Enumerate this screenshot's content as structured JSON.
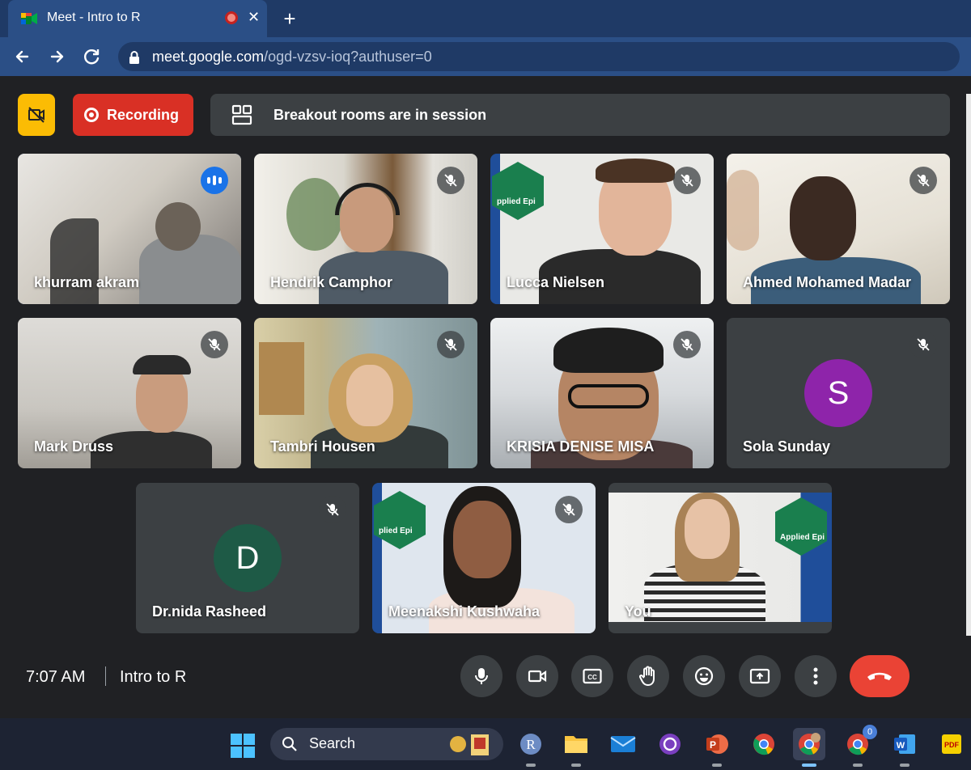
{
  "browser": {
    "tab_title": "Meet - Intro to R",
    "new_tab": "+",
    "close_tab": "✕",
    "url_host": "meet.google.com",
    "url_path": "/ogd-vzsv-ioq?authuser=0"
  },
  "meet": {
    "recording_label": "Recording",
    "breakout_label": "Breakout rooms are in session",
    "time": "7:07 AM",
    "meeting_title": "Intro to R",
    "participants": [
      {
        "name": "khurram akram"
      },
      {
        "name": "Hendrik Camphor"
      },
      {
        "name": "Lucca Nielsen"
      },
      {
        "name": "Ahmed Mohamed Madar"
      },
      {
        "name": "Mark Druss"
      },
      {
        "name": "Tambri Housen"
      },
      {
        "name": "KRISIA DENISE MISA"
      },
      {
        "name": "Sola Sunday",
        "initial": "S",
        "avatar_color": "#8e24aa"
      },
      {
        "name": "Dr.nida Rasheed",
        "initial": "D",
        "avatar_color": "#1e5a46"
      },
      {
        "name": "Meenakshi Kushwaha"
      },
      {
        "name": "You"
      }
    ],
    "badge_text": "Applied Epi",
    "badge_text_clip": "plied Epi",
    "badge_text_clip2": "pplied Epi"
  },
  "taskbar": {
    "search_label": "Search",
    "notification_count": "0"
  },
  "colors": {
    "accent_blue": "#1a73e8",
    "record_red": "#d93025",
    "end_call_red": "#ea4335",
    "warning_yellow": "#fbbc04"
  }
}
